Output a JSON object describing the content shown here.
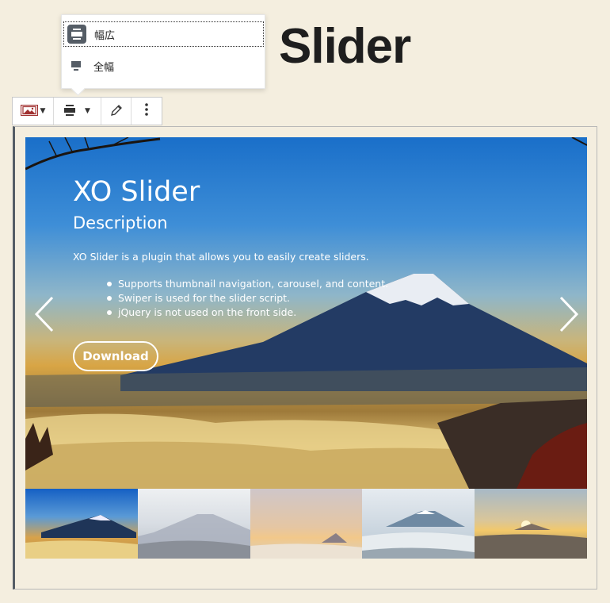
{
  "page": {
    "title": "Slider"
  },
  "alignment_menu": {
    "items": [
      {
        "label": "幅広",
        "icon": "wide-width-icon",
        "active": true
      },
      {
        "label": "全幅",
        "icon": "full-width-icon",
        "active": false
      }
    ]
  },
  "toolbar": {
    "buttons": [
      {
        "name": "slider-block-icon"
      },
      {
        "name": "align-wide-icon"
      },
      {
        "name": "edit-pencil-icon"
      },
      {
        "name": "more-options-icon"
      }
    ]
  },
  "slider": {
    "title": "XO Slider",
    "subtitle": "Description",
    "text": "XO Slider is a plugin that allows you to easily create sliders.",
    "list": [
      "Supports thumbnail navigation, carousel, and content.",
      "Swiper is used for the slider script.",
      "jQuery is not used on the front side."
    ],
    "button_label": "Download",
    "thumbnail_count": 5
  },
  "colors": {
    "background": "#f4eedf",
    "toolbar_accent": "#555d66",
    "icon_red": "#a03030"
  }
}
